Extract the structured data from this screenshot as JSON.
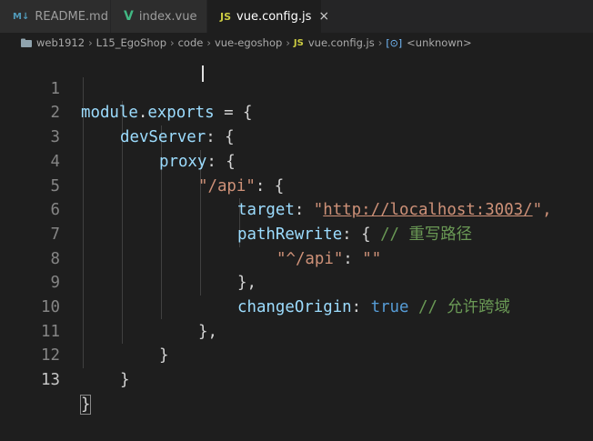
{
  "tabs": [
    {
      "icon": "M↓",
      "label": "README.md"
    },
    {
      "icon": "V",
      "label": "index.vue"
    },
    {
      "icon": "JS",
      "label": "vue.config.js",
      "close": "×"
    }
  ],
  "breadcrumb": {
    "folders": [
      "web1912",
      "L15_EgoShop",
      "code",
      "vue-egoshop"
    ],
    "file_icon": "JS",
    "file": "vue.config.js",
    "symbol": "<unknown>"
  },
  "editor": {
    "line_numbers": [
      "1",
      "2",
      "3",
      "4",
      "5",
      "6",
      "7",
      "8",
      "9",
      "10",
      "11",
      "12",
      "13"
    ],
    "tokens": {
      "module": "module",
      "dot": ".",
      "exports": "exports",
      "eq_brace": " = {",
      "devServer": "devServer",
      "colon_brace": ": {",
      "proxy": "proxy",
      "api_key": "\"/api\"",
      "target": "target",
      "colon_space": ": ",
      "q_open": "\"",
      "url": "http://localhost:3003/",
      "q_close_comma": "\",",
      "pathRewrite": "pathRewrite",
      "brace_open": "{ ",
      "cmt1": "// 重写路径",
      "rewrite_key": "\"^/api\"",
      "rewrite_val": "\"\"",
      "close_brace_comma": "},",
      "changeOrigin": "changeOrigin",
      "true": "true",
      "cmt2": "// 允许跨域",
      "close_brace": "}"
    }
  }
}
